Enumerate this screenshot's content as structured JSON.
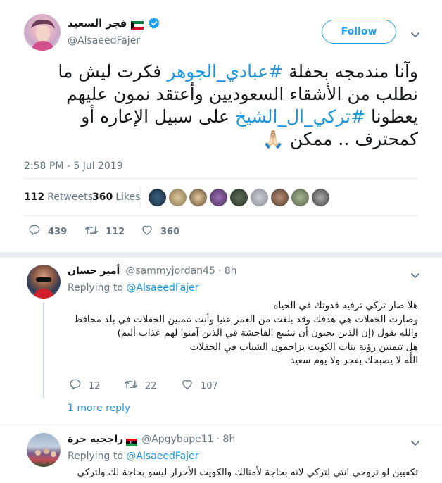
{
  "main_tweet": {
    "author_name": "فجر السعيد",
    "author_handle": "@AlsaeedFajer",
    "follow_label": "Follow",
    "text_parts": [
      {
        "t": "وآنا مندمجه بحفلة ",
        "hash": false
      },
      {
        "t": "#عبادي_الجوهر",
        "hash": true
      },
      {
        "t": " فكرت ليش ما نطلب من الأشقاء السعوديين وأعتقد نمون عليهم يعطونا ",
        "hash": false
      },
      {
        "t": "#تركي_ال_الشيخ",
        "hash": true
      },
      {
        "t": " على سبيل الإعاره أو كمحترف .. ممكن 🙏🏻",
        "hash": false
      }
    ],
    "timestamp": "2:58 PM - 5 Jul 2019",
    "retweets_count": "112",
    "retweets_label": "Retweets",
    "likes_count": "360",
    "likes_label": "Likes",
    "actions": {
      "replies": "439",
      "retweets": "112",
      "likes": "360"
    }
  },
  "replies": [
    {
      "author_name": "أمير حسان",
      "author_handle": "@sammyjordan45",
      "time": "· 8h",
      "replying_label": "Replying to",
      "replying_to": "@AlsaeedFajer",
      "lines": [
        "هلا صار تركي ترفيه قدوتك في الحياه",
        "وصارت الحفلات هي هدفك وقد بلغت من العمر عتيا وأنت تتمنين الحفلات في بلد محافظ",
        "والله يقول (إن الذين يحبون أن تشيع الفاحشة في الذين آمنوا لهم عذاب أليم)",
        "هل تتمنين رؤية بنات الكويت يزاحمون الشباب في الحفلات",
        "اللَّه لا يصبحك بفجر ولا يوم سعيد"
      ],
      "actions": {
        "replies": "12",
        "retweets": "22",
        "likes": "107"
      },
      "more_replies": "1 more reply"
    },
    {
      "author_name": "راجحيه حرة",
      "author_handle": "@Apgybape11",
      "time": "· 8h",
      "replying_label": "Replying to",
      "replying_to": "@AlsaeedFajer",
      "lines": [
        "تكفيين لو تروحي انتي لتركي لانه بحاجة لأمثالك والكويت الأحرار ليسو بحاجة لك ولتركي"
      ]
    }
  ],
  "icons": {
    "verified": "verified-badge-icon",
    "flag_kuwait": "kuwait-flag-icon",
    "flag_libya": "libya-flag-icon",
    "reply": "reply-icon",
    "retweet": "retweet-icon",
    "like": "heart-icon",
    "more": "chevron-down-icon"
  },
  "colors": {
    "accent": "#1da1f2",
    "link": "#1b95e0",
    "muted": "#657786",
    "divider": "#e6ecf0"
  }
}
